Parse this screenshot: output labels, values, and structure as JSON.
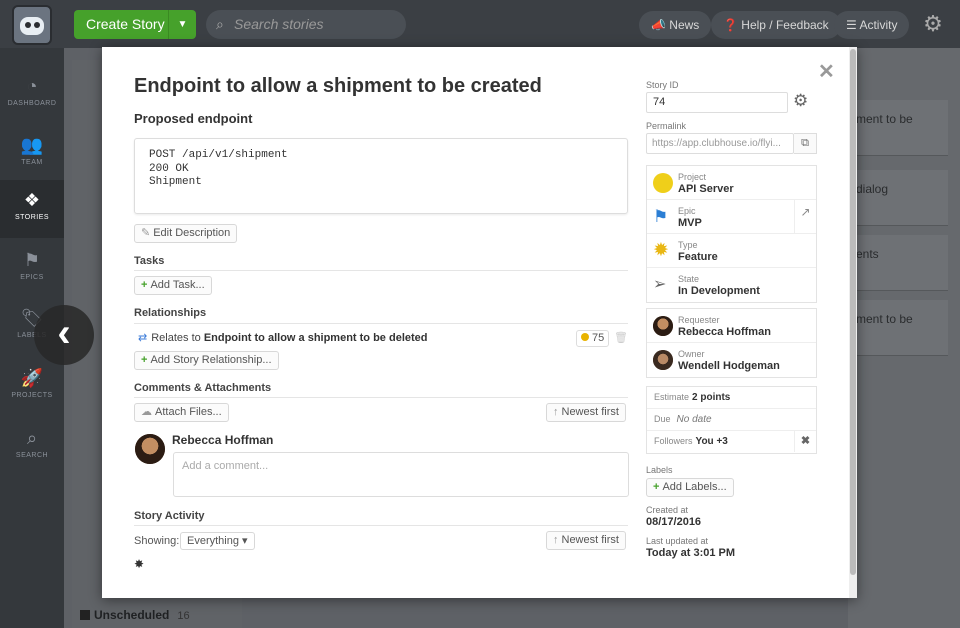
{
  "topbar": {
    "create_label": "Create Story",
    "search_placeholder": "Search stories",
    "news_label": "News",
    "help_label": "Help / Feedback",
    "activity_label": "Activity"
  },
  "sidebar": {
    "items": [
      {
        "label": "DASHBOARD",
        "icon": "dashboard-icon"
      },
      {
        "label": "TEAM",
        "icon": "team-icon"
      },
      {
        "label": "STORIES",
        "icon": "stories-icon"
      },
      {
        "label": "EPICS",
        "icon": "epics-icon"
      },
      {
        "label": "LABELS",
        "icon": "labels-icon"
      },
      {
        "label": "PROJECTS",
        "icon": "projects-icon"
      },
      {
        "label": "SEARCH",
        "icon": "search-icon"
      }
    ]
  },
  "background": {
    "cards": [
      "ment to be",
      "dialog",
      "ents",
      "ment to be"
    ],
    "unscheduled_label": "Unscheduled",
    "unscheduled_count": "16"
  },
  "story": {
    "title": "Endpoint to allow a shipment to be created",
    "description_heading": "Proposed endpoint",
    "description_code": [
      "POST /api/v1/shipment",
      "",
      "200 OK",
      "Shipment"
    ],
    "edit_description_label": "Edit Description",
    "tasks_heading": "Tasks",
    "add_task_label": "Add Task...",
    "relationships_heading": "Relationships",
    "relation_prefix": "Relates to",
    "relation_target": "Endpoint to allow a shipment to be deleted",
    "relation_id": "75",
    "add_relationship_label": "Add Story Relationship...",
    "comments_heading": "Comments & Attachments",
    "attach_label": "Attach Files...",
    "newest_first_label": "Newest first",
    "commenter_name": "Rebecca Hoffman",
    "comment_placeholder": "Add a comment...",
    "activity_heading": "Story Activity",
    "showing_label": "Showing:",
    "showing_value": "Everything"
  },
  "details": {
    "story_id_label": "Story ID",
    "story_id": "74",
    "permalink_label": "Permalink",
    "permalink": "https://app.clubhouse.io/flyi...",
    "project_label": "Project",
    "project_value": "API Server",
    "epic_label": "Epic",
    "epic_value": "MVP",
    "type_label": "Type",
    "type_value": "Feature",
    "state_label": "State",
    "state_value": "In Development",
    "requester_label": "Requester",
    "requester_value": "Rebecca Hoffman",
    "owner_label": "Owner",
    "owner_value": "Wendell Hodgeman",
    "estimate_label": "Estimate",
    "estimate_value": "2 points",
    "due_label": "Due",
    "due_value": "No date",
    "followers_label": "Followers",
    "followers_value": "You +3",
    "labels_label": "Labels",
    "add_labels_label": "Add Labels...",
    "created_label": "Created at",
    "created_value": "08/17/2016",
    "updated_label": "Last updated at",
    "updated_value": "Today at 3:01 PM"
  },
  "colors": {
    "brand_green": "#46a12b",
    "project_yellow": "#efcf1a",
    "epic_blue": "#2b7ed4"
  }
}
